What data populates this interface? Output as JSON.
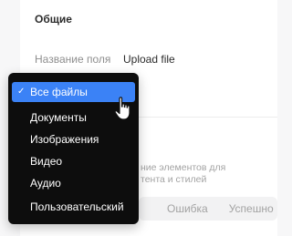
{
  "panel": {
    "section_title": "Общие",
    "field": {
      "label": "Название поля",
      "value": "Upload file"
    },
    "description_lines": [
      "ние элементов для",
      "тента и стилей"
    ],
    "status_segment": {
      "options": [
        "Ошибка",
        "Успешно"
      ]
    }
  },
  "dropdown": {
    "items": [
      {
        "label": "Все файлы",
        "selected": true
      },
      {
        "label": "Документы"
      },
      {
        "label": "Изображения"
      },
      {
        "label": "Видео"
      },
      {
        "label": "Аудио"
      },
      {
        "label": "Пользовательский"
      }
    ],
    "check_icon": "check-icon",
    "accent_color": "#3b82f6",
    "background_color": "#0d0d0d"
  },
  "cursor": {
    "icon": "hand-pointer-icon"
  }
}
